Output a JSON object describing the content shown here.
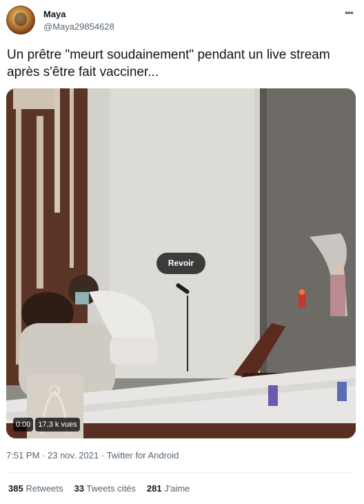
{
  "author": {
    "name": "Maya",
    "handle": "@Maya29854628"
  },
  "tweet": {
    "text": "Un prêtre \"meurt soudainement\" pendant un live stream après s'être fait vacciner..."
  },
  "video": {
    "replay_label": "Revoir",
    "time": "0:00",
    "views": "17,3 k vues"
  },
  "meta": {
    "time": "7:51 PM",
    "date": "23 nov. 2021",
    "source": "Twitter for Android"
  },
  "stats": {
    "retweets_count": "385",
    "retweets_label": "Retweets",
    "quotes_count": "33",
    "quotes_label": "Tweets cités",
    "likes_count": "281",
    "likes_label": "J'aime"
  },
  "icons": {
    "more": "more-horizontal-icon"
  }
}
